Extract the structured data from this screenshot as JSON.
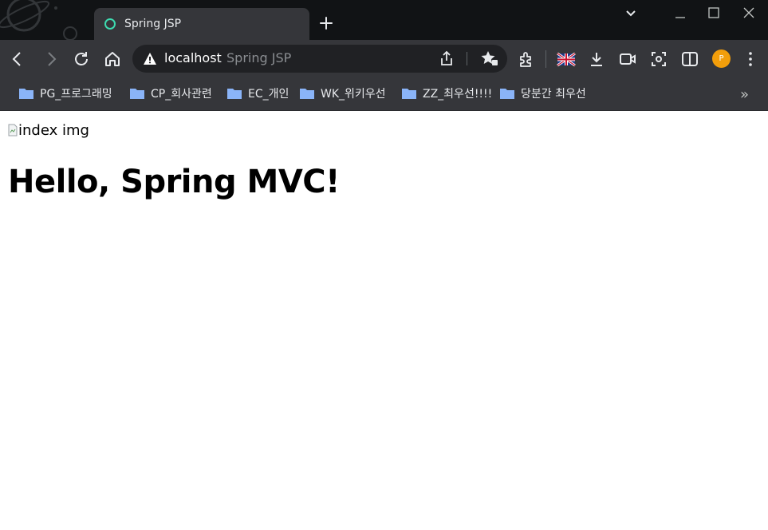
{
  "browser": {
    "tab": {
      "title": "Spring JSP",
      "favicon": "circle-icon"
    },
    "toolbar": {
      "buttons": [
        "back-icon",
        "forward-icon",
        "reload-icon",
        "home-icon"
      ],
      "extensions": [
        "puzzle-icon",
        "flag-uk-icon",
        "download-icon",
        "video-icon",
        "screenshot-icon",
        "sidepanel-icon"
      ],
      "profile_initial": "P",
      "profile_color": "#f29e0b"
    },
    "omnibox": {
      "host": "localhost",
      "title": "Spring JSP",
      "security_icon": "warning-icon"
    },
    "bookmarks": [
      {
        "label": "PG_프로그래밍"
      },
      {
        "label": "CP_회사관련"
      },
      {
        "label": "EC_개인"
      },
      {
        "label": "WK_위키우선"
      },
      {
        "label": "ZZ_최우선!!!!"
      },
      {
        "label": "당분간 최우선"
      }
    ],
    "bookmarks_more": "»"
  },
  "page": {
    "image_alt": "index img",
    "heading": "Hello, Spring MVC!"
  },
  "colors": {
    "titlebar": "#111315",
    "toolbar": "#35363a",
    "omnibox": "#202124",
    "tab_favicon": "#3ddbb0",
    "folder": "#8ab4f8"
  }
}
